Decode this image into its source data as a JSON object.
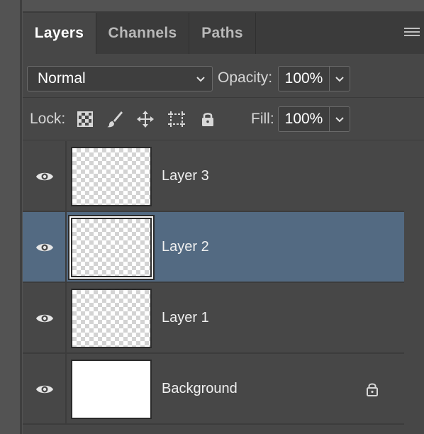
{
  "tabs": [
    {
      "label": "Layers",
      "active": true
    },
    {
      "label": "Channels",
      "active": false
    },
    {
      "label": "Paths",
      "active": false
    }
  ],
  "panel_menu_icon": "hamburger-menu-icon",
  "blend": {
    "mode": "Normal",
    "opacity_label": "Opacity:",
    "opacity_value": "100%"
  },
  "lock": {
    "label": "Lock:",
    "icons": [
      "lock-transparent-pixels-icon",
      "lock-image-pixels-icon",
      "lock-position-icon",
      "lock-artboard-icon",
      "lock-all-icon"
    ],
    "fill_label": "Fill:",
    "fill_value": "100%"
  },
  "layers": [
    {
      "name": "Layer 3",
      "visible": true,
      "selected": false,
      "thumbnail": "transparent",
      "locked": false
    },
    {
      "name": "Layer 2",
      "visible": true,
      "selected": true,
      "thumbnail": "transparent",
      "locked": false
    },
    {
      "name": "Layer 1",
      "visible": true,
      "selected": false,
      "thumbnail": "transparent",
      "locked": false
    },
    {
      "name": "Background",
      "visible": true,
      "selected": false,
      "thumbnail": "white",
      "locked": true
    }
  ],
  "colors": {
    "panel_bg": "#474747",
    "selected_row": "#536a82",
    "tabbar_bg": "#3b3b3b"
  }
}
